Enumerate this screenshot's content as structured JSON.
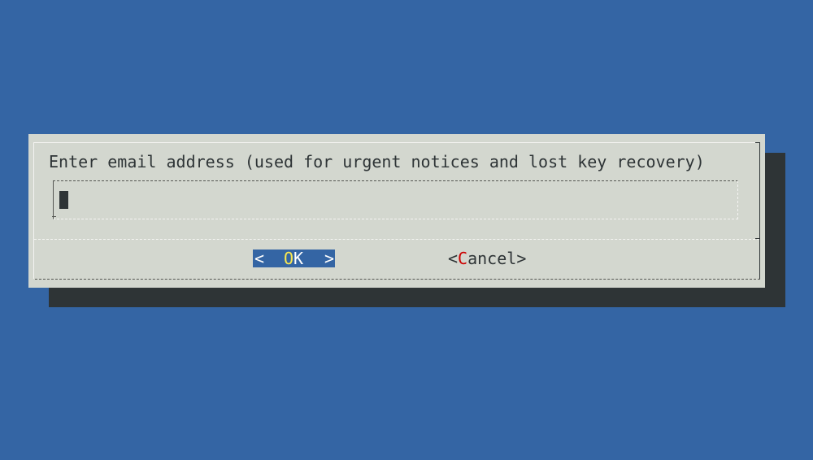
{
  "dialog": {
    "prompt": "Enter email address (used for urgent notices and lost key recovery)",
    "input": {
      "value": "",
      "placeholder": ""
    },
    "buttons": {
      "ok": {
        "left_bracket": "<",
        "label_hot": "O",
        "label_rest": "K",
        "right_bracket": ">"
      },
      "cancel": {
        "left_bracket": "<",
        "label_hot": "C",
        "label_rest": "ancel",
        "right_bracket": ">"
      }
    }
  },
  "colors": {
    "background": "#3465a4",
    "dialog": "#d3d7cf",
    "shadow": "#2e3436",
    "selected_button": "#3465a4",
    "hotkey_selected": "#fce94f",
    "hotkey": "#cc0000"
  }
}
